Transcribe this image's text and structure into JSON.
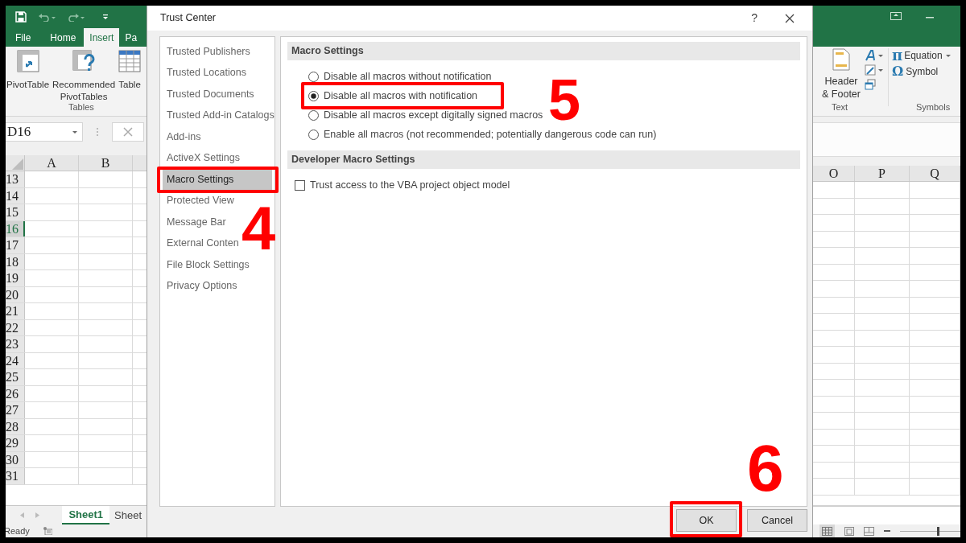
{
  "excel": {
    "tabs": [
      {
        "label": "File",
        "selected": false
      },
      {
        "label": "Home",
        "selected": false
      },
      {
        "label": "Insert",
        "selected": true
      },
      {
        "label": "Pa",
        "selected": false
      }
    ],
    "ribbon_left": {
      "buttons": [
        {
          "label": "PivotTable"
        },
        {
          "label": "Recommended PivotTables"
        },
        {
          "label": "Table"
        }
      ],
      "group": "Tables"
    },
    "ribbon_right": {
      "header_footer": "Header & Footer",
      "text_group": "Text",
      "equation_icon": "π",
      "equation": "Equation",
      "symbol_icon": "Ω",
      "symbol": "Symbol",
      "symbols_group": "Symbols"
    },
    "name_box": "D16",
    "columns_left": [
      "A",
      "B"
    ],
    "columns_right": [
      "O",
      "P",
      "Q"
    ],
    "rows": [
      {
        "label": "13",
        "selected": false
      },
      {
        "label": "14",
        "selected": false
      },
      {
        "label": "15",
        "selected": false
      },
      {
        "label": "16",
        "selected": true
      },
      {
        "label": "17",
        "selected": false
      },
      {
        "label": "18",
        "selected": false
      },
      {
        "label": "19",
        "selected": false
      },
      {
        "label": "20",
        "selected": false
      },
      {
        "label": "21",
        "selected": false
      },
      {
        "label": "22",
        "selected": false
      },
      {
        "label": "23",
        "selected": false
      },
      {
        "label": "24",
        "selected": false
      },
      {
        "label": "25",
        "selected": false
      },
      {
        "label": "26",
        "selected": false
      },
      {
        "label": "27",
        "selected": false
      },
      {
        "label": "28",
        "selected": false
      },
      {
        "label": "29",
        "selected": false
      },
      {
        "label": "30",
        "selected": false
      },
      {
        "label": "31",
        "selected": false
      }
    ],
    "sheet_tabs": [
      {
        "label": "Sheet1",
        "selected": true
      },
      {
        "label": "Sheet",
        "selected": false
      }
    ],
    "status": "Ready",
    "zoom": {
      "level": 0.5
    }
  },
  "dialog": {
    "title": "Trust Center",
    "help": "?",
    "nav": [
      {
        "label": "Trusted Publishers",
        "selected": false
      },
      {
        "label": "Trusted Locations",
        "selected": false
      },
      {
        "label": "Trusted Documents",
        "selected": false
      },
      {
        "label": "Trusted Add-in Catalogs",
        "selected": false
      },
      {
        "label": "Add-ins",
        "selected": false
      },
      {
        "label": "ActiveX Settings",
        "selected": false
      },
      {
        "label": "Macro Settings",
        "selected": true,
        "callout": "4"
      },
      {
        "label": "Protected View",
        "selected": false
      },
      {
        "label": "Message Bar",
        "selected": false
      },
      {
        "label": "External Conten",
        "selected": false
      },
      {
        "label": "File Block Settings",
        "selected": false
      },
      {
        "label": "Privacy Options",
        "selected": false
      }
    ],
    "sections": [
      {
        "heading": "Macro Settings",
        "kind": "radio",
        "options": [
          {
            "label": "Disable all macros without notification",
            "selected": false
          },
          {
            "label": "Disable all macros with notification",
            "selected": true,
            "callout": "5"
          },
          {
            "label": "Disable all macros except digitally signed macros",
            "selected": false
          },
          {
            "label": "Enable all macros (not recommended; potentially dangerous code can run)",
            "selected": false
          }
        ]
      },
      {
        "heading": "Developer Macro Settings",
        "kind": "checkbox",
        "options": [
          {
            "label": "Trust access to the VBA project object model",
            "checked": false
          }
        ]
      }
    ],
    "buttons": [
      {
        "label": "OK",
        "callout": "6"
      },
      {
        "label": "Cancel"
      }
    ]
  }
}
